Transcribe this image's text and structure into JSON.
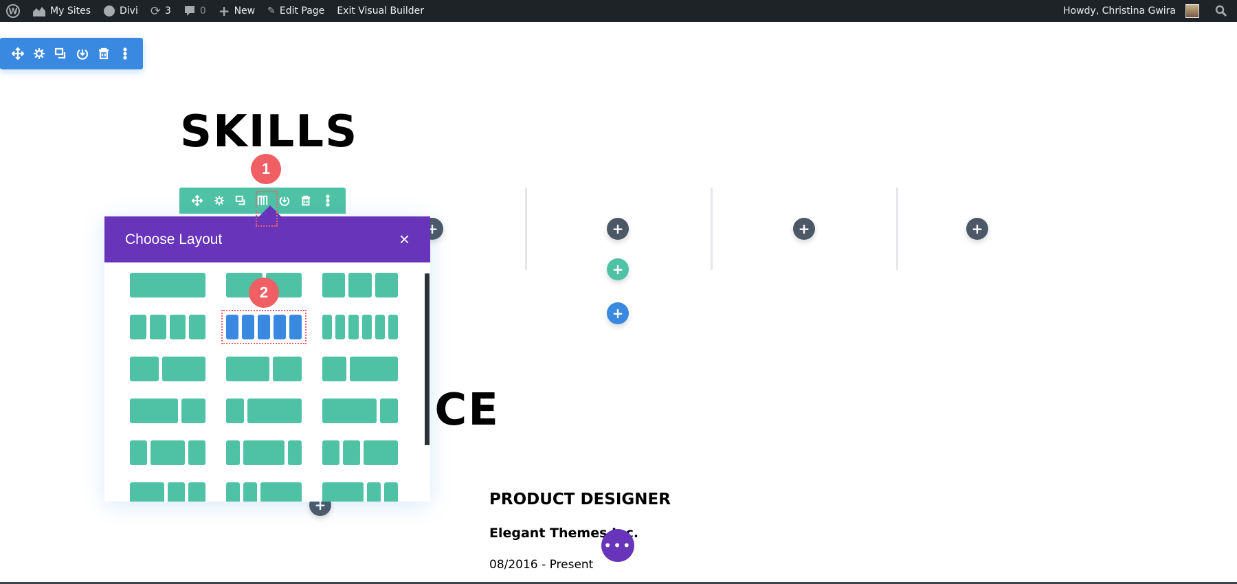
{
  "admin_bar": {
    "my_sites": "My Sites",
    "site_name": "Divi",
    "updates_count": "3",
    "comments_count": "0",
    "new_label": "New",
    "edit_page": "Edit Page",
    "exit_builder": "Exit Visual Builder",
    "greeting": "Howdy, Christina Gwira"
  },
  "page": {
    "skills_heading": "SKILLS",
    "experience_heading": "EXPERIENCE",
    "job_title": "PRODUCT DESIGNER",
    "company": "Elegant Themes Inc.",
    "dates": "08/2016 - Present"
  },
  "annotations": {
    "step1": "1",
    "step2": "2"
  },
  "layout_popup": {
    "title": "Choose Layout",
    "close_icon": "×",
    "selected_layout": "1/5 1/5 1/5 1/5 1/5",
    "layouts": [
      [
        1
      ],
      [
        1,
        1
      ],
      [
        1,
        1,
        1
      ],
      [
        1,
        1,
        1,
        1
      ],
      [
        1,
        1,
        1,
        1,
        1
      ],
      [
        1,
        1,
        1,
        1,
        1,
        1
      ],
      [
        2,
        3
      ],
      [
        3,
        2
      ],
      [
        1,
        2
      ],
      [
        2,
        1
      ],
      [
        1,
        3
      ],
      [
        3,
        1
      ],
      [
        1,
        2,
        1
      ],
      [
        1,
        3,
        1
      ],
      [
        1,
        1,
        2
      ],
      [
        2,
        1,
        1
      ],
      [
        1,
        1,
        3
      ],
      [
        3,
        1,
        1
      ]
    ]
  },
  "colors": {
    "section_blue": "#3a89e0",
    "row_teal": "#4fc2a6",
    "popup_purple": "#6734ba",
    "annotation_red": "#ef5f63",
    "admin_bar": "#1d2327"
  }
}
